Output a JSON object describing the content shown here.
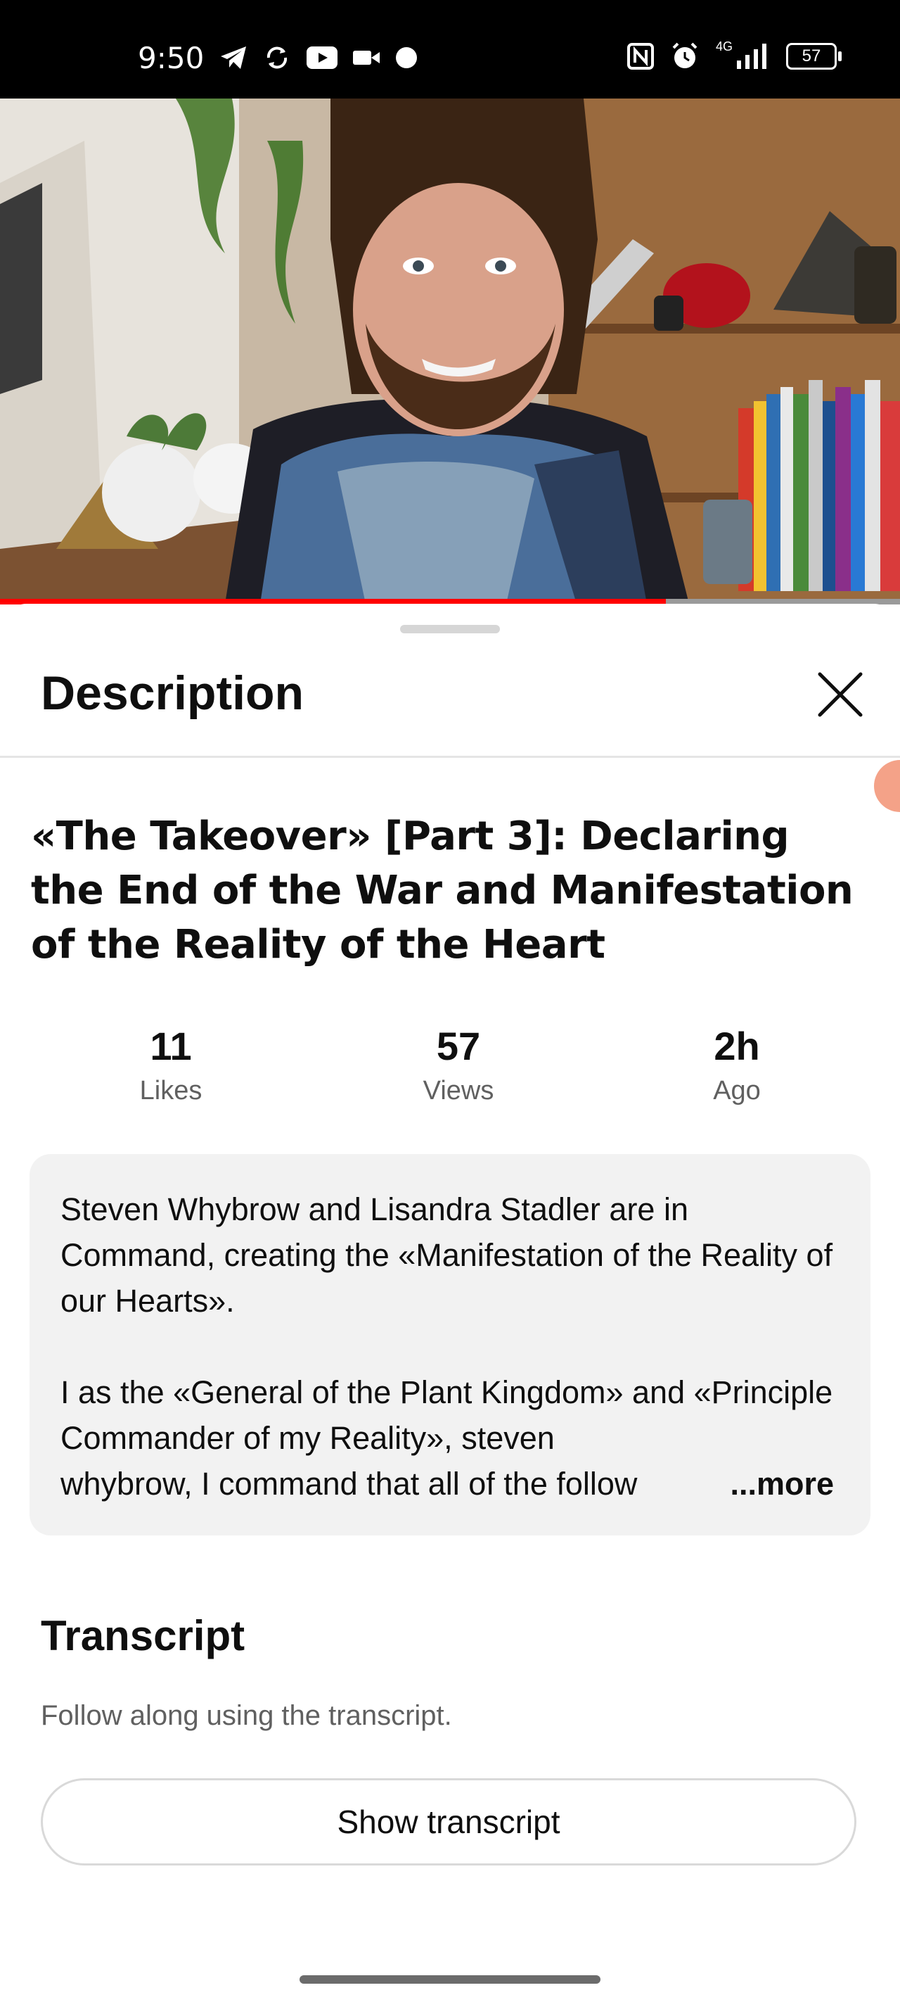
{
  "status_bar": {
    "time": "9:50",
    "network": "4G",
    "battery": "57"
  },
  "video": {
    "progress": 0.74
  },
  "sheet": {
    "title": "Description"
  },
  "video_info": {
    "title": "«The Takeover» [Part 3]: Declaring the End of the War and Manifestation of the Reality of the Heart",
    "stats": [
      {
        "value": "11",
        "label": "Likes"
      },
      {
        "value": "57",
        "label": "Views"
      },
      {
        "value": "2h",
        "label": "Ago"
      }
    ],
    "description": {
      "paragraph1": "Steven Whybrow and Lisandra Stadler are in Command, creating the «Manifestation of the Reality of our Hearts».",
      "paragraph2_visible": "I as the «General of the Plant Kingdom» and «Principle Commander of my Reality», steven",
      "paragraph2_last_line": "whybrow, I command that all of the follow",
      "more_label": "...more"
    }
  },
  "transcript": {
    "title": "Transcript",
    "subtitle": "Follow along using the transcript.",
    "button_label": "Show transcript"
  },
  "colors": {
    "accent": "#ff0000",
    "scroll_indicator": "#f4a288"
  }
}
